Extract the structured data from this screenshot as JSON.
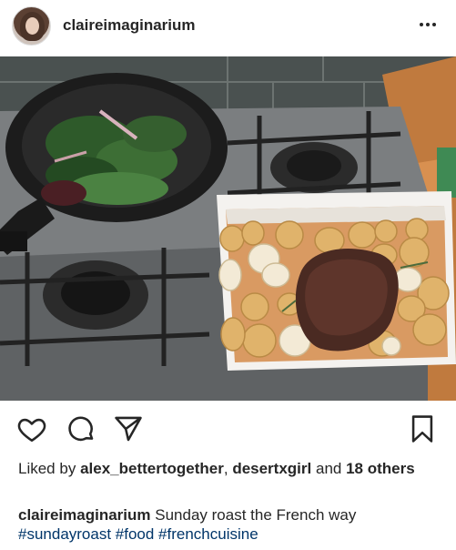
{
  "post": {
    "username": "claireimaginarium",
    "image_alt": "",
    "likes": {
      "prefix": "Liked by",
      "user1": "alex_bettertogether",
      "sep": ",",
      "user2": "desertxgirl",
      "and": "and",
      "others": "18 others"
    },
    "caption": {
      "username": "claireimaginarium",
      "text": "Sunday roast the French way",
      "hashtags": "#sundayroast #food #frenchcuisine"
    }
  },
  "icons": {
    "more": "more-options-icon",
    "like": "heart-icon",
    "comment": "comment-icon",
    "share": "send-icon",
    "save": "bookmark-icon"
  },
  "colors": {
    "text": "#262626",
    "link": "#003569",
    "background": "#ffffff"
  }
}
